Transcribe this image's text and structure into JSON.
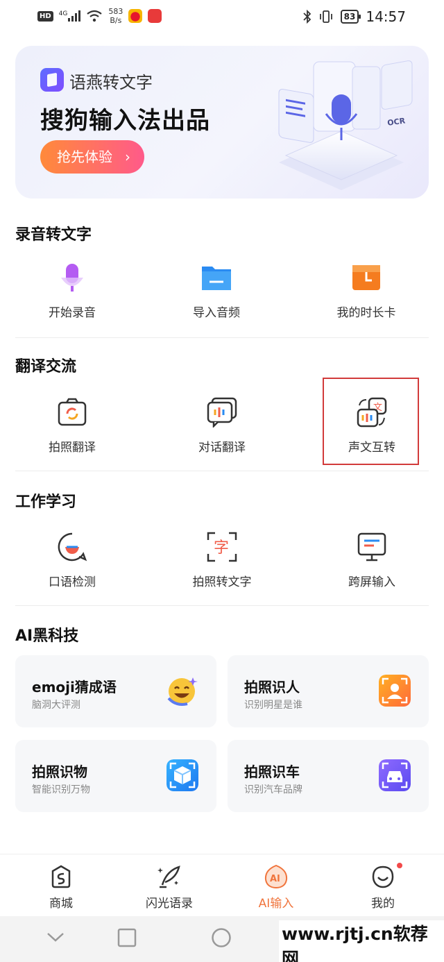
{
  "status_bar": {
    "network": "HD",
    "signal": "4G",
    "speed_value": "583",
    "speed_unit": "B/s",
    "battery": "83",
    "time": "14:57"
  },
  "banner": {
    "brand": "语燕转文字",
    "title": "搜狗输入法出品",
    "cta": "抢先体验",
    "art_label": "OCR"
  },
  "sections": {
    "recording": {
      "title": "录音转文字",
      "items": [
        {
          "label": "开始录音",
          "icon": "microphone-icon"
        },
        {
          "label": "导入音频",
          "icon": "folder-icon"
        },
        {
          "label": "我的时长卡",
          "icon": "clock-card-icon"
        }
      ]
    },
    "translation": {
      "title": "翻译交流",
      "items": [
        {
          "label": "拍照翻译",
          "icon": "camera-translate-icon"
        },
        {
          "label": "对话翻译",
          "icon": "dialogue-translate-icon"
        },
        {
          "label": "声文互转",
          "icon": "voice-text-convert-icon"
        }
      ]
    },
    "work": {
      "title": "工作学习",
      "items": [
        {
          "label": "口语检测",
          "icon": "speech-check-icon"
        },
        {
          "label": "拍照转文字",
          "icon": "photo-to-text-icon",
          "glyph": "字"
        },
        {
          "label": "跨屏输入",
          "icon": "cross-screen-icon"
        }
      ]
    },
    "ai": {
      "title": "AI黑科技",
      "cards": [
        {
          "title": "emoji猜成语",
          "subtitle": "脑洞大评测",
          "icon": "emoji-icon"
        },
        {
          "title": "拍照识人",
          "subtitle": "识别明星是谁",
          "icon": "person-recognize-icon"
        },
        {
          "title": "拍照识物",
          "subtitle": "智能识别万物",
          "icon": "object-recognize-icon"
        },
        {
          "title": "拍照识车",
          "subtitle": "识别汽车品牌",
          "icon": "car-recognize-icon"
        }
      ]
    }
  },
  "tabbar": {
    "tabs": [
      {
        "label": "商城",
        "icon": "store-icon"
      },
      {
        "label": "闪光语录",
        "icon": "quill-icon"
      },
      {
        "label": "AI输入",
        "icon": "ai-input-icon",
        "active": true,
        "glyph": "AI"
      },
      {
        "label": "我的",
        "icon": "profile-icon"
      }
    ]
  },
  "watermark": "www.rjtj.cn软荐网",
  "colors": {
    "accent": "#f0743c",
    "highlight_border": "#d23a3a",
    "cta_start": "#ff8a3a",
    "cta_end": "#ff5a8a"
  }
}
